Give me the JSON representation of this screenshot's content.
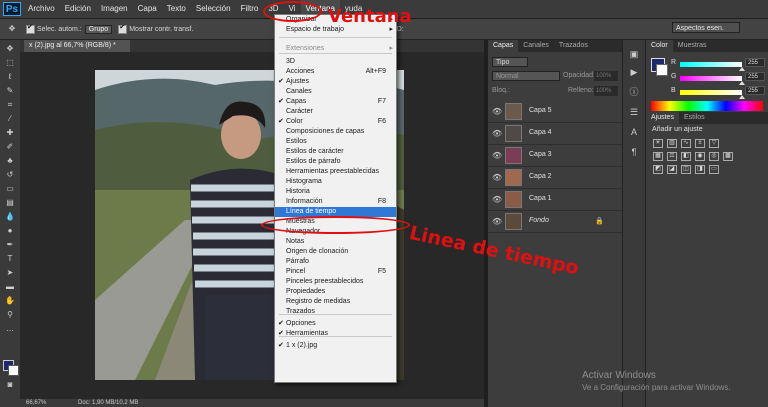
{
  "menubar": {
    "logo": "Ps",
    "items": [
      "Archivo",
      "Edición",
      "Imagen",
      "Capa",
      "Texto",
      "Selección",
      "Filtro",
      "3D",
      "Vi",
      "Ventana",
      "yuda"
    ]
  },
  "options": {
    "auto_select": "Selec. autom.:",
    "group": "Grupo",
    "show_transform": "Mostrar contr. transf.",
    "mode3d": "Modo 3D:",
    "workspace": "Aspectos esen."
  },
  "document": {
    "tab": "x (2).jpg al 66,7% (RGB/8) *",
    "zoom": "66,67%",
    "doc_info": "Doc: 1,90 MB/10,2 MB"
  },
  "window_menu": {
    "items": [
      {
        "label": "Organizar",
        "check": false,
        "shortcut": "",
        "submenu": true,
        "gray": false,
        "highlight": false
      },
      {
        "label": "Espacio de trabajo",
        "check": false,
        "shortcut": "",
        "submenu": true,
        "gray": false,
        "highlight": false
      },
      {
        "label": "Extensiones",
        "check": false,
        "shortcut": "",
        "submenu": true,
        "gray": true,
        "highlight": false
      },
      {
        "label": "3D",
        "check": false,
        "shortcut": "",
        "submenu": false,
        "gray": false,
        "highlight": false
      },
      {
        "label": "Acciones",
        "check": false,
        "shortcut": "Alt+F9",
        "submenu": false,
        "gray": false,
        "highlight": false
      },
      {
        "label": "Ajustes",
        "check": true,
        "shortcut": "",
        "submenu": false,
        "gray": false,
        "highlight": false
      },
      {
        "label": "Canales",
        "check": false,
        "shortcut": "",
        "submenu": false,
        "gray": false,
        "highlight": false
      },
      {
        "label": "Capas",
        "check": true,
        "shortcut": "F7",
        "submenu": false,
        "gray": false,
        "highlight": false
      },
      {
        "label": "Carácter",
        "check": false,
        "shortcut": "",
        "submenu": false,
        "gray": false,
        "highlight": false
      },
      {
        "label": "Color",
        "check": true,
        "shortcut": "F6",
        "submenu": false,
        "gray": false,
        "highlight": false
      },
      {
        "label": "Composiciones de capas",
        "check": false,
        "shortcut": "",
        "submenu": false,
        "gray": false,
        "highlight": false
      },
      {
        "label": "Estilos",
        "check": false,
        "shortcut": "",
        "submenu": false,
        "gray": false,
        "highlight": false
      },
      {
        "label": "Estilos de carácter",
        "check": false,
        "shortcut": "",
        "submenu": false,
        "gray": false,
        "highlight": false
      },
      {
        "label": "Estilos de párrafo",
        "check": false,
        "shortcut": "",
        "submenu": false,
        "gray": false,
        "highlight": false
      },
      {
        "label": "Herramientas preestablecidas",
        "check": false,
        "shortcut": "",
        "submenu": false,
        "gray": false,
        "highlight": false
      },
      {
        "label": "Histograma",
        "check": false,
        "shortcut": "",
        "submenu": false,
        "gray": false,
        "highlight": false
      },
      {
        "label": "Historia",
        "check": false,
        "shortcut": "",
        "submenu": false,
        "gray": false,
        "highlight": false
      },
      {
        "label": "Información",
        "check": false,
        "shortcut": "F8",
        "submenu": false,
        "gray": false,
        "highlight": false
      },
      {
        "label": "Línea de tiempo",
        "check": false,
        "shortcut": "",
        "submenu": false,
        "gray": false,
        "highlight": true
      },
      {
        "label": "Muestras",
        "check": false,
        "shortcut": "",
        "submenu": false,
        "gray": false,
        "highlight": false
      },
      {
        "label": "Navegador",
        "check": false,
        "shortcut": "",
        "submenu": false,
        "gray": false,
        "highlight": false
      },
      {
        "label": "Notas",
        "check": false,
        "shortcut": "",
        "submenu": false,
        "gray": false,
        "highlight": false
      },
      {
        "label": "Origen de clonación",
        "check": false,
        "shortcut": "",
        "submenu": false,
        "gray": false,
        "highlight": false
      },
      {
        "label": "Párrafo",
        "check": false,
        "shortcut": "",
        "submenu": false,
        "gray": false,
        "highlight": false
      },
      {
        "label": "Pincel",
        "check": false,
        "shortcut": "F5",
        "submenu": false,
        "gray": false,
        "highlight": false
      },
      {
        "label": "Pinceles preestablecidos",
        "check": false,
        "shortcut": "",
        "submenu": false,
        "gray": false,
        "highlight": false
      },
      {
        "label": "Propiedades",
        "check": false,
        "shortcut": "",
        "submenu": false,
        "gray": false,
        "highlight": false
      },
      {
        "label": "Registro de medidas",
        "check": false,
        "shortcut": "",
        "submenu": false,
        "gray": false,
        "highlight": false
      },
      {
        "label": "Trazados",
        "check": false,
        "shortcut": "",
        "submenu": false,
        "gray": false,
        "highlight": false
      },
      {
        "label": "Opciones",
        "check": true,
        "shortcut": "",
        "submenu": false,
        "gray": false,
        "highlight": false
      },
      {
        "label": "Herramientas",
        "check": true,
        "shortcut": "",
        "submenu": false,
        "gray": false,
        "highlight": false
      },
      {
        "label": "1 x (2).jpg",
        "check": true,
        "shortcut": "",
        "submenu": false,
        "gray": false,
        "highlight": false
      }
    ]
  },
  "layers_panel": {
    "tabs": [
      "Capas",
      "Canales",
      "Trazados"
    ],
    "filter": "Tipo",
    "blend_mode": "Normal",
    "opacity_label": "Opacidad:",
    "opacity_value": "100%",
    "lock_label": "Bloq.:",
    "fill_label": "Relleno:",
    "fill_value": "100%",
    "layers": [
      {
        "name": "Capa 5",
        "italic": false,
        "color": "#6b5a4c"
      },
      {
        "name": "Capa 4",
        "italic": false,
        "color": "#4f4a48"
      },
      {
        "name": "Capa 3",
        "italic": false,
        "color": "#7a3d55"
      },
      {
        "name": "Capa 2",
        "italic": false,
        "color": "#a0694e"
      },
      {
        "name": "Capa 1",
        "italic": false,
        "color": "#8a5b45"
      },
      {
        "name": "Fondo",
        "italic": true,
        "color": "#5b4a3a"
      }
    ]
  },
  "color_panel": {
    "tabs": [
      "Color",
      "Muestras"
    ],
    "channels": [
      {
        "label": "R",
        "value": "255",
        "gradient": "linear-gradient(to right,#00ffff,#ffffff)",
        "knob": 1.0
      },
      {
        "label": "G",
        "value": "255",
        "gradient": "linear-gradient(to right,#ff00ff,#ffffff)",
        "knob": 1.0
      },
      {
        "label": "B",
        "value": "255",
        "gradient": "linear-gradient(to right,#ffff00,#ffffff)",
        "knob": 1.0
      }
    ]
  },
  "adjustments_panel": {
    "tabs": [
      "Ajustes",
      "Estilos"
    ],
    "title": "Añadir un ajuste"
  },
  "annotations": {
    "ventana": "Ventana",
    "linea": "Linea de tiempo"
  },
  "watermark": {
    "line1": "Activar Windows",
    "line2": "Ve a Configuración para activar Windows."
  }
}
